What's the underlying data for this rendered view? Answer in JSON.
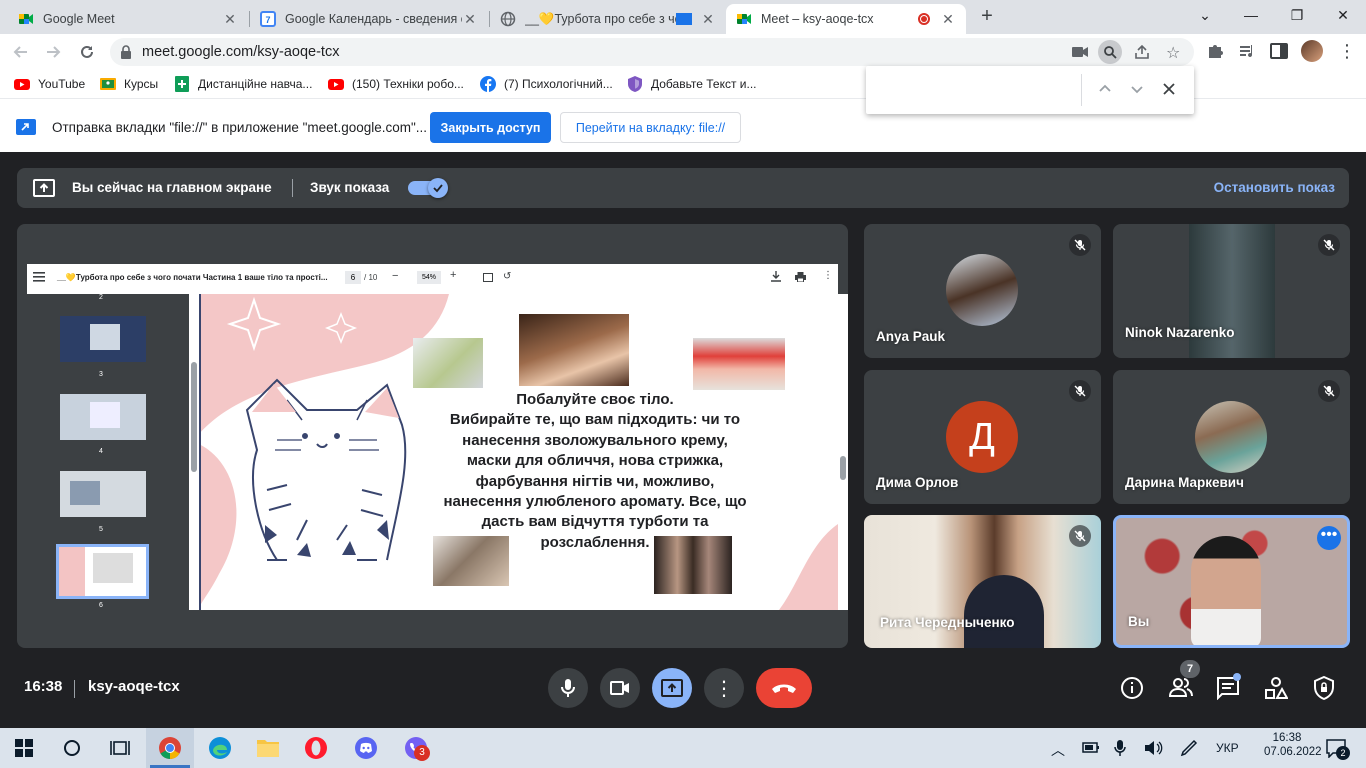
{
  "browser": {
    "tabs": [
      {
        "title": "Google Meet",
        "icon": "google-meet-icon",
        "active": false
      },
      {
        "title": "Google Календарь - сведения о",
        "icon": "google-calendar-icon",
        "active": false
      },
      {
        "title": "__💛Турбота про себе з чо",
        "icon": "globe-icon",
        "active": false
      },
      {
        "title": "Meet – ksy-aoqe-tcx",
        "icon": "google-meet-icon",
        "active": true
      }
    ],
    "url": "meet.google.com/ksy-aoqe-tcx",
    "bookmarks": [
      "YouTube",
      "Курсы",
      "Дистанційне навча...",
      "(150) Техніки робо...",
      "(7) Психологічний...",
      "Добавьте Текст и..."
    ],
    "calendar_badge": "7"
  },
  "infobar": {
    "message": "Отправка вкладки \"file://\" в приложение \"meet.google.com\"...",
    "primary_button": "Закрыть доступ",
    "secondary_button": "Перейти на вкладку: file://"
  },
  "meet": {
    "presenting_text": "Вы сейчас на главном экране",
    "audio_label": "Звук показа",
    "stop_label": "Остановить показ",
    "time": "16:38",
    "meeting_code": "ksy-aoqe-tcx",
    "participants_count": "7",
    "participants": [
      {
        "name": "Anya Pauk"
      },
      {
        "name": "Ninok Nazarenko"
      },
      {
        "name": "Дима Орлов",
        "initial": "Д",
        "color": "#c5401c"
      },
      {
        "name": "Дарина Маркевич"
      },
      {
        "name": "Рита Чередныченко"
      },
      {
        "name": "Вы"
      }
    ],
    "accent": "#8ab4f8",
    "end_call_color": "#ea4335"
  },
  "pdf": {
    "title": "__💛Турбота про себе з чого почати Частина 1 ваше тіло та прості...",
    "page_current": "6",
    "page_total": "/ 10",
    "zoom": "54%",
    "thumbs": [
      "2",
      "3",
      "4",
      "5",
      "6"
    ],
    "slide_heading": "Побалуйте своє тіло.",
    "slide_lines": [
      "Вибирайте те, що вам підходить: чи то",
      "нанесення зволожувального крему,",
      "маски для обличчя, нова стрижка,",
      "фарбування нігтів чи, можливо,",
      "нанесення улюбленого аромату. Все, що",
      "дасть вам відчуття турботи та",
      "розслаблення."
    ]
  },
  "taskbar": {
    "lang": "УКР",
    "time": "16:38",
    "date": "07.06.2022",
    "viber_badge": "3",
    "notif_badge": "2"
  }
}
